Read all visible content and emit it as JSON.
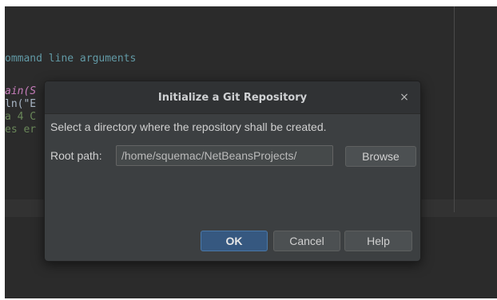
{
  "editor": {
    "lines": [
      "ommand line arguments",
      "ain(S",
      "ln(\"E",
      "a 4 C",
      "es er"
    ]
  },
  "dialog": {
    "title": "Initialize a Git Repository",
    "close_glyph": "×",
    "message": "Select a directory where the repository shall be created.",
    "root_path_label": "Root path:",
    "root_path_value": "/home/squemac/NetBeansProjects/",
    "browse_label": "Browse",
    "ok_label": "OK",
    "cancel_label": "Cancel",
    "help_label": "Help"
  },
  "colors": {
    "editor_bg": "#2b2b2b",
    "dialog_bg": "#3c3f41",
    "default_button": "#365880",
    "comment": "#629aa6"
  }
}
